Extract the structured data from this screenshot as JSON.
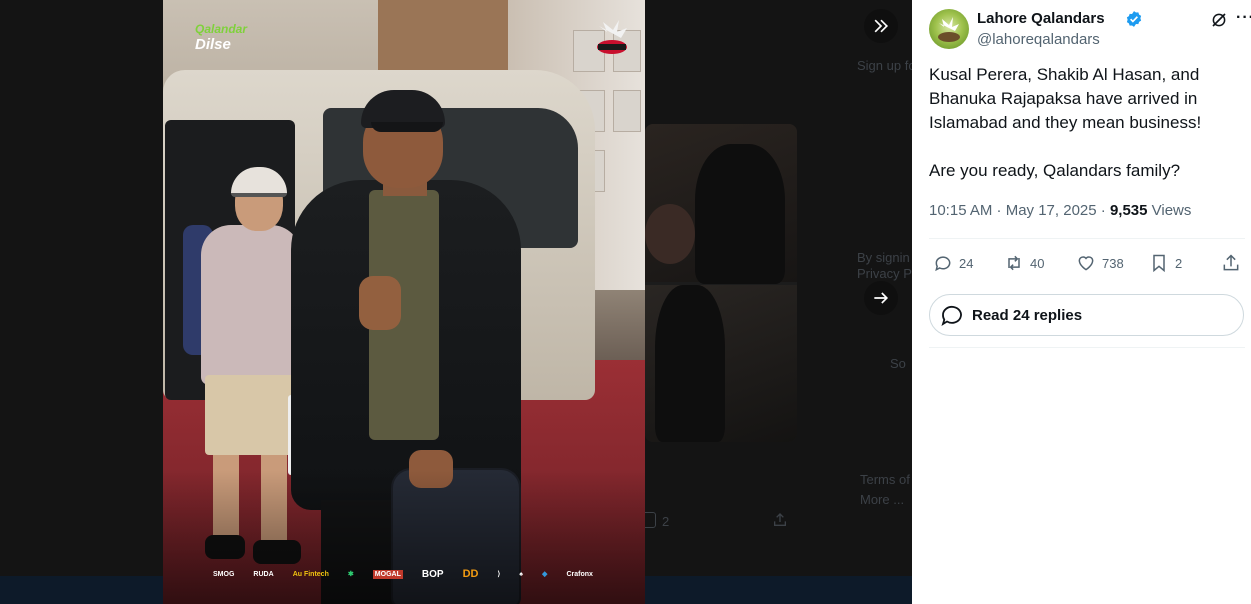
{
  "photo": {
    "brand_line1": "Qalandar",
    "brand_line2": "Dilse",
    "logo_text": "QALANDARS",
    "sponsors": [
      "SMOG",
      "RUDA",
      "Au Fintech",
      "",
      "MOGAL",
      "BOP",
      "DD",
      "",
      "",
      "",
      "Crafonx"
    ]
  },
  "background": {
    "line1": "Sign up fo",
    "line2": "By signin",
    "line3": "Privacy P",
    "line4": "So",
    "line5": "Terms of S",
    "line6": "More ...",
    "count": "2"
  },
  "tweet": {
    "account_name": "Lahore Qalandars",
    "handle": "@lahoreqalandars",
    "more_label": "···",
    "text_p1": "Kusal Perera, Shakib Al Hasan, and Bhanuka Rajapaksa have arrived in Islamabad and they mean business!",
    "text_p2": "Are you ready, Qalandars family?",
    "meta_time": "10:15 AM · May 17, 2025 · ",
    "meta_views_count": "9,535",
    "meta_views_label": " Views",
    "actions": {
      "replies": "24",
      "reposts": "40",
      "likes": "738",
      "bookmarks": "2"
    },
    "read_replies_label": "Read 24 replies"
  },
  "colors": {
    "verified": "#1d9bf0",
    "text_primary": "#0f1419",
    "text_secondary": "#536471",
    "border": "#cfd9de"
  },
  "icons": {
    "collapse": "double-chevron-right-icon",
    "next": "arrow-right-icon",
    "reply": "reply-icon",
    "repost": "repost-icon",
    "like": "heart-icon",
    "bookmark": "bookmark-icon",
    "share": "share-icon",
    "grok": "grok-icon",
    "more": "more-icon",
    "verified": "verified-badge-icon"
  }
}
